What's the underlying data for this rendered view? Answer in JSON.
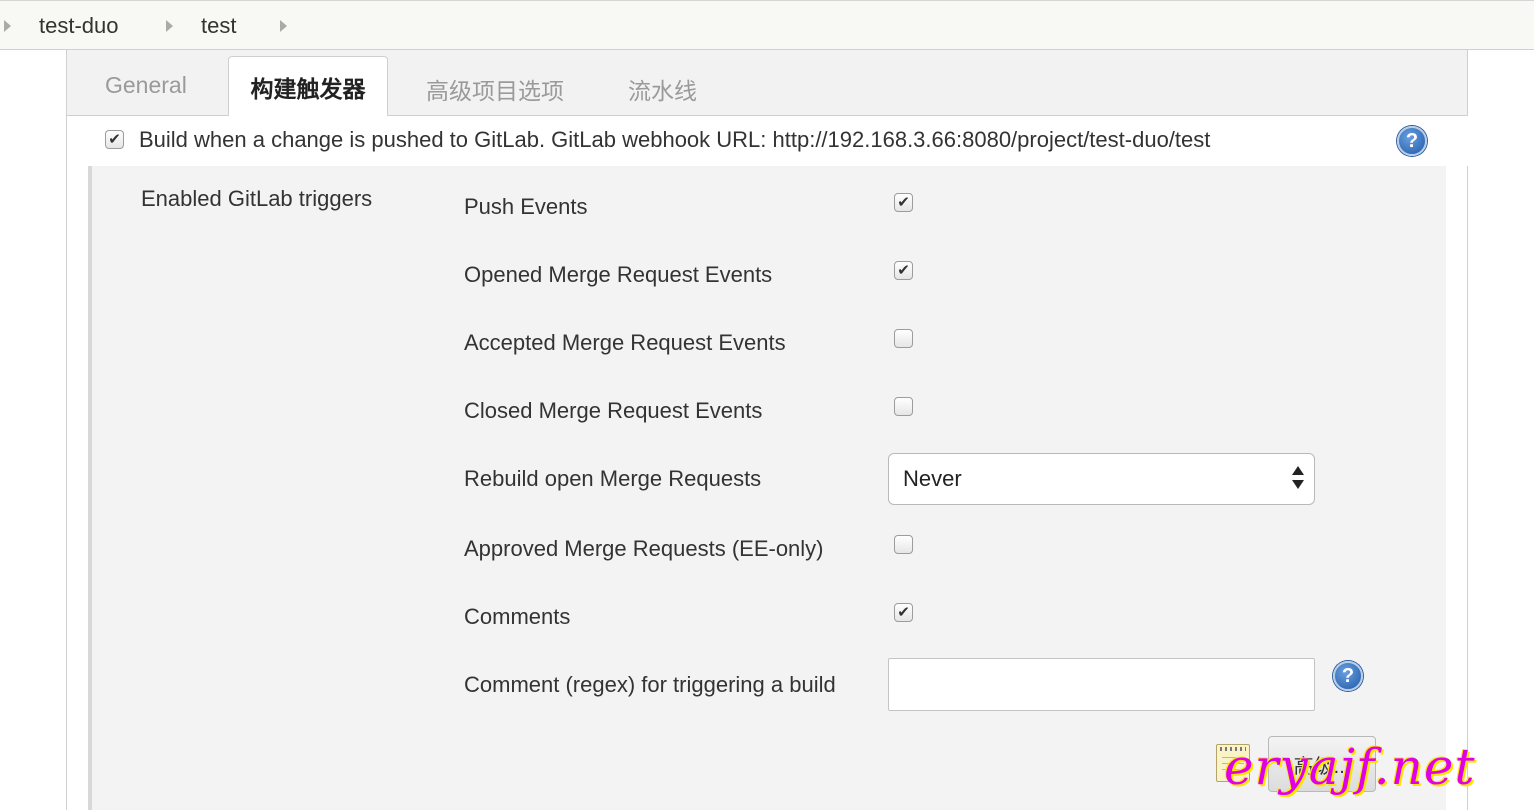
{
  "breadcrumb": {
    "items": [
      "test-duo",
      "test"
    ]
  },
  "tabs": [
    {
      "label": "General",
      "active": false
    },
    {
      "label": "构建触发器",
      "active": true
    },
    {
      "label": "高级项目选项",
      "active": false
    },
    {
      "label": "流水线",
      "active": false
    }
  ],
  "trigger": {
    "checked": true,
    "label": "Build when a change is pushed to GitLab. GitLab webhook URL: http://192.168.3.66:8080/project/test-duo/test",
    "help_icon": "help-icon"
  },
  "enabled_triggers": {
    "section_label": "Enabled GitLab triggers",
    "push_events": {
      "label": "Push Events",
      "checked": true
    },
    "opened_mr": {
      "label": "Opened Merge Request Events",
      "checked": true
    },
    "accepted_mr": {
      "label": "Accepted Merge Request Events",
      "checked": false
    },
    "closed_mr": {
      "label": "Closed Merge Request Events",
      "checked": false
    },
    "rebuild_open_mr": {
      "label": "Rebuild open Merge Requests",
      "value": "Never"
    },
    "approved_mr": {
      "label": "Approved Merge Requests (EE-only)",
      "checked": false
    },
    "comments": {
      "label": "Comments",
      "checked": true
    },
    "comment_regex": {
      "label": "Comment (regex) for triggering a build",
      "value": ""
    }
  },
  "advanced_button": {
    "label": "高级..."
  },
  "watermark": {
    "text": "eryajf.net"
  },
  "colors": {
    "section_bg": "#f3f3f3",
    "tabbar_bg": "#f2f2f2",
    "breadcrumb_bg": "#f8f9f4",
    "help_blue": "#1f5aa8",
    "watermark": "#e000e8"
  },
  "check_glyph": "✔"
}
